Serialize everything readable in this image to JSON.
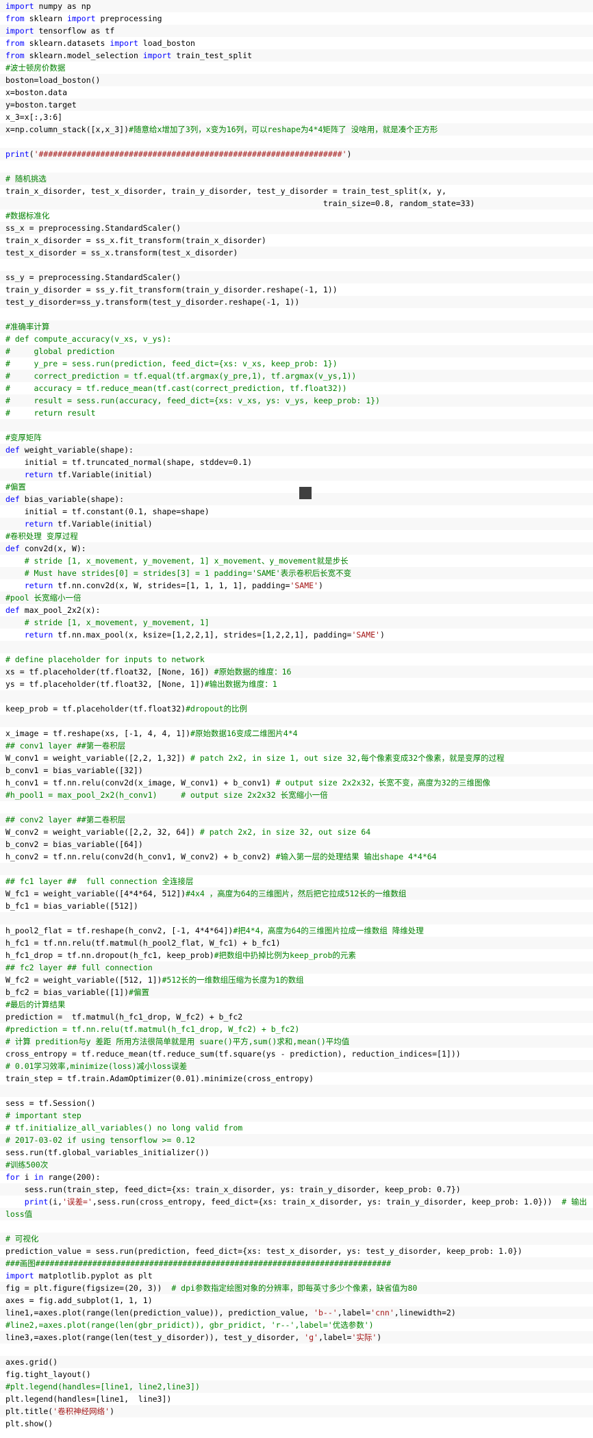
{
  "lines": [
    [
      [
        "import",
        "kw"
      ],
      [
        " numpy as np",
        ""
      ]
    ],
    [
      [
        "from",
        "kw"
      ],
      [
        " sklearn ",
        ""
      ],
      [
        "import",
        "kw"
      ],
      [
        " preprocessing",
        ""
      ]
    ],
    [
      [
        "import",
        "kw"
      ],
      [
        " tensorflow as tf",
        ""
      ]
    ],
    [
      [
        "from",
        "kw"
      ],
      [
        " sklearn.datasets ",
        ""
      ],
      [
        "import",
        "kw"
      ],
      [
        " load_boston",
        ""
      ]
    ],
    [
      [
        "from",
        "kw"
      ],
      [
        " sklearn.model_selection ",
        ""
      ],
      [
        "import",
        "kw"
      ],
      [
        " train_test_split",
        ""
      ]
    ],
    [
      [
        "#波士顿房价数据",
        "cm"
      ]
    ],
    [
      [
        "boston=load_boston()",
        ""
      ]
    ],
    [
      [
        "x=boston.data",
        ""
      ]
    ],
    [
      [
        "y=boston.target",
        ""
      ]
    ],
    [
      [
        "x_3=x[:,3:6]",
        ""
      ]
    ],
    [
      [
        "x=np.column_stack([x,x_3])",
        ""
      ],
      [
        "#随意给x增加了3列，x变为16列，可以reshape为4*4矩阵了 没啥用，就是凑个正方形",
        "cm"
      ]
    ],
    [
      [
        "",
        ""
      ]
    ],
    [
      [
        "print",
        "kw"
      ],
      [
        "(",
        ""
      ],
      [
        "'################################################################'",
        "st"
      ],
      [
        ")",
        ""
      ]
    ],
    [
      [
        "",
        ""
      ]
    ],
    [
      [
        "# 随机挑选",
        "cm"
      ]
    ],
    [
      [
        "train_x_disorder, test_x_disorder, train_y_disorder, test_y_disorder = train_test_split(x, y,",
        ""
      ]
    ],
    [
      [
        "                                                                   train_size=0.8, random_state=33)",
        ""
      ]
    ],
    [
      [
        "#数据标准化",
        "cm"
      ]
    ],
    [
      [
        "ss_x = preprocessing.StandardScaler()",
        ""
      ]
    ],
    [
      [
        "train_x_disorder = ss_x.fit_transform(train_x_disorder)",
        ""
      ]
    ],
    [
      [
        "test_x_disorder = ss_x.transform(test_x_disorder)",
        ""
      ]
    ],
    [
      [
        "",
        ""
      ]
    ],
    [
      [
        "ss_y = preprocessing.StandardScaler()",
        ""
      ]
    ],
    [
      [
        "train_y_disorder = ss_y.fit_transform(train_y_disorder.reshape(-1, 1))",
        ""
      ]
    ],
    [
      [
        "test_y_disorder=ss_y.transform(test_y_disorder.reshape(-1, 1))",
        ""
      ]
    ],
    [
      [
        "",
        ""
      ]
    ],
    [
      [
        "#准确率计算",
        "cm"
      ]
    ],
    [
      [
        "# def compute_accuracy(v_xs, v_ys):",
        "cm"
      ]
    ],
    [
      [
        "#     global prediction",
        "cm"
      ]
    ],
    [
      [
        "#     y_pre = sess.run(prediction, feed_dict={xs: v_xs, keep_prob: 1})",
        "cm"
      ]
    ],
    [
      [
        "#     correct_prediction = tf.equal(tf.argmax(y_pre,1), tf.argmax(v_ys,1))",
        "cm"
      ]
    ],
    [
      [
        "#     accuracy = tf.reduce_mean(tf.cast(correct_prediction, tf.float32))",
        "cm"
      ]
    ],
    [
      [
        "#     result = sess.run(accuracy, feed_dict={xs: v_xs, ys: v_ys, keep_prob: 1})",
        "cm"
      ]
    ],
    [
      [
        "#     return result",
        "cm"
      ]
    ],
    [
      [
        "",
        ""
      ]
    ],
    [
      [
        "#变厚矩阵",
        "cm"
      ]
    ],
    [
      [
        "def",
        "kw"
      ],
      [
        " weight_variable(shape):",
        ""
      ]
    ],
    [
      [
        "    initial = tf.truncated_normal(shape, stddev=0.1)",
        ""
      ]
    ],
    [
      [
        "    ",
        ""
      ],
      [
        "return",
        "kw"
      ],
      [
        " tf.Variable(initial)",
        ""
      ]
    ],
    [
      [
        "#偏置",
        "cm"
      ]
    ],
    [
      [
        "def",
        "kw"
      ],
      [
        " bias_variable(shape):",
        ""
      ]
    ],
    [
      [
        "    initial = tf.constant(0.1, shape=shape)",
        ""
      ]
    ],
    [
      [
        "    ",
        ""
      ],
      [
        "return",
        "kw"
      ],
      [
        " tf.Variable(initial)",
        ""
      ]
    ],
    [
      [
        "#卷积处理 变厚过程",
        "cm"
      ]
    ],
    [
      [
        "def",
        "kw"
      ],
      [
        " conv2d(x, W):",
        ""
      ]
    ],
    [
      [
        "    # stride [1, x_movement, y_movement, 1] x_movement、y_movement就是步长",
        "cm"
      ]
    ],
    [
      [
        "    # Must have strides[0] = strides[3] = 1 padding='SAME'表示卷积后长宽不变",
        "cm"
      ]
    ],
    [
      [
        "    ",
        ""
      ],
      [
        "return",
        "kw"
      ],
      [
        " tf.nn.conv2d(x, W, strides=[1, 1, 1, 1], padding=",
        ""
      ],
      [
        "'SAME'",
        "st"
      ],
      [
        ")",
        ""
      ]
    ],
    [
      [
        "#pool 长宽缩小一倍",
        "cm"
      ]
    ],
    [
      [
        "def",
        "kw"
      ],
      [
        " max_pool_2x2(x):",
        ""
      ]
    ],
    [
      [
        "    # stride [1, x_movement, y_movement, 1]",
        "cm"
      ]
    ],
    [
      [
        "    ",
        ""
      ],
      [
        "return",
        "kw"
      ],
      [
        " tf.nn.max_pool(x, ksize=[1,2,2,1], strides=[1,2,2,1], padding=",
        ""
      ],
      [
        "'SAME'",
        "st"
      ],
      [
        ")",
        ""
      ]
    ],
    [
      [
        "",
        ""
      ]
    ],
    [
      [
        "# define placeholder for inputs to network",
        "cm"
      ]
    ],
    [
      [
        "xs = tf.placeholder(tf.float32, [None, 16]) ",
        ""
      ],
      [
        "#原始数据的维度：16",
        "cm"
      ]
    ],
    [
      [
        "ys = tf.placeholder(tf.float32, [None, 1])",
        ""
      ],
      [
        "#输出数据为维度：1",
        "cm"
      ]
    ],
    [
      [
        "",
        ""
      ]
    ],
    [
      [
        "keep_prob = tf.placeholder(tf.float32)",
        ""
      ],
      [
        "#dropout的比例",
        "cm"
      ]
    ],
    [
      [
        "",
        ""
      ]
    ],
    [
      [
        "x_image = tf.reshape(xs, [-1, 4, 4, 1])",
        ""
      ],
      [
        "#原始数据16变成二维图片4*4",
        "cm"
      ]
    ],
    [
      [
        "## conv1 layer ##第一卷积层",
        "cm"
      ]
    ],
    [
      [
        "W_conv1 = weight_variable([2,2, 1,32]) ",
        ""
      ],
      [
        "# patch 2x2, in size 1, out size 32,每个像素变成32个像素，就是变厚的过程",
        "cm"
      ]
    ],
    [
      [
        "b_conv1 = bias_variable([32])",
        ""
      ]
    ],
    [
      [
        "h_conv1 = tf.nn.relu(conv2d(x_image, W_conv1) + b_conv1) ",
        ""
      ],
      [
        "# output size 2x2x32，长宽不变，高度为32的三维图像",
        "cm"
      ]
    ],
    [
      [
        "#h_pool1 = max_pool_2x2(h_conv1)     # output size 2x2x32 长宽缩小一倍",
        "cm"
      ]
    ],
    [
      [
        "",
        ""
      ]
    ],
    [
      [
        "## conv2 layer ##第二卷积层",
        "cm"
      ]
    ],
    [
      [
        "W_conv2 = weight_variable([2,2, 32, 64]) ",
        ""
      ],
      [
        "# patch 2x2, in size 32, out size 64",
        "cm"
      ]
    ],
    [
      [
        "b_conv2 = bias_variable([64])",
        ""
      ]
    ],
    [
      [
        "h_conv2 = tf.nn.relu(conv2d(h_conv1, W_conv2) + b_conv2) ",
        ""
      ],
      [
        "#输入第一层的处理结果 输出shape 4*4*64",
        "cm"
      ]
    ],
    [
      [
        "",
        ""
      ]
    ],
    [
      [
        "## fc1 layer ##  full connection 全连接层",
        "cm"
      ]
    ],
    [
      [
        "W_fc1 = weight_variable([4*4*64, 512])",
        ""
      ],
      [
        "#4x4 ，高度为64的三维图片，然后把它拉成512长的一维数组",
        "cm"
      ]
    ],
    [
      [
        "b_fc1 = bias_variable([512])",
        ""
      ]
    ],
    [
      [
        "",
        ""
      ]
    ],
    [
      [
        "h_pool2_flat = tf.reshape(h_conv2, [-1, 4*4*64])",
        ""
      ],
      [
        "#把4*4，高度为64的三维图片拉成一维数组 降维处理",
        "cm"
      ]
    ],
    [
      [
        "h_fc1 = tf.nn.relu(tf.matmul(h_pool2_flat, W_fc1) + b_fc1)",
        ""
      ]
    ],
    [
      [
        "h_fc1_drop = tf.nn.dropout(h_fc1, keep_prob)",
        ""
      ],
      [
        "#把数组中扔掉比例为keep_prob的元素",
        "cm"
      ]
    ],
    [
      [
        "## fc2 layer ## full connection",
        "cm"
      ]
    ],
    [
      [
        "W_fc2 = weight_variable([512, 1])",
        ""
      ],
      [
        "#512长的一维数组压缩为长度为1的数组",
        "cm"
      ]
    ],
    [
      [
        "b_fc2 = bias_variable([1])",
        ""
      ],
      [
        "#偏置",
        "cm"
      ]
    ],
    [
      [
        "#最后的计算结果",
        "cm"
      ]
    ],
    [
      [
        "prediction =  tf.matmul(h_fc1_drop, W_fc2) + b_fc2",
        ""
      ]
    ],
    [
      [
        "#prediction = tf.nn.relu(tf.matmul(h_fc1_drop, W_fc2) + b_fc2)",
        "cm"
      ]
    ],
    [
      [
        "# 计算 predition与y 差距 所用方法很简单就是用 suare()平方,sum()求和,mean()平均值",
        "cm"
      ]
    ],
    [
      [
        "cross_entropy = tf.reduce_mean(tf.reduce_sum(tf.square(ys - prediction), reduction_indices=[1]))",
        ""
      ]
    ],
    [
      [
        "# 0.01学习效率,minimize(loss)减小loss误差",
        "cm"
      ]
    ],
    [
      [
        "train_step = tf.train.AdamOptimizer(0.01).minimize(cross_entropy)",
        ""
      ]
    ],
    [
      [
        "",
        ""
      ]
    ],
    [
      [
        "sess = tf.Session()",
        ""
      ]
    ],
    [
      [
        "# important step",
        "cm"
      ]
    ],
    [
      [
        "# tf.initialize_all_variables() no long valid from",
        "cm"
      ]
    ],
    [
      [
        "# 2017-03-02 if using tensorflow >= 0.12",
        "cm"
      ]
    ],
    [
      [
        "sess.run(tf.global_variables_initializer())",
        ""
      ]
    ],
    [
      [
        "#训练500次",
        "cm"
      ]
    ],
    [
      [
        "for",
        "kw"
      ],
      [
        " i ",
        ""
      ],
      [
        "in",
        "kw"
      ],
      [
        " range(200):",
        ""
      ]
    ],
    [
      [
        "    sess.run(train_step, feed_dict={xs: train_x_disorder, ys: train_y_disorder, keep_prob: 0.7})",
        ""
      ]
    ],
    [
      [
        "    ",
        ""
      ],
      [
        "print",
        "kw"
      ],
      [
        "(i,",
        ""
      ],
      [
        "'误差='",
        "st"
      ],
      [
        ",sess.run(cross_entropy, feed_dict={xs: train_x_disorder, ys: train_y_disorder, keep_prob: 1.0}))  ",
        ""
      ],
      [
        "# 输出",
        "cm"
      ]
    ],
    [
      [
        "loss值",
        "cm"
      ]
    ],
    [
      [
        "",
        ""
      ]
    ],
    [
      [
        "# 可视化",
        "cm"
      ]
    ],
    [
      [
        "prediction_value = sess.run(prediction, feed_dict={xs: test_x_disorder, ys: test_y_disorder, keep_prob: 1.0})",
        ""
      ]
    ],
    [
      [
        "###画图###########################################################################",
        "cm"
      ]
    ],
    [
      [
        "import",
        "kw"
      ],
      [
        " matplotlib.pyplot as plt",
        ""
      ]
    ],
    [
      [
        "fig = plt.figure(figsize=(20, 3))  ",
        ""
      ],
      [
        "# dpi参数指定绘图对象的分辨率，即每英寸多少个像素，缺省值为80",
        "cm"
      ]
    ],
    [
      [
        "axes = fig.add_subplot(1, 1, 1)",
        ""
      ]
    ],
    [
      [
        "line1,=axes.plot(range(len(prediction_value)), prediction_value, ",
        ""
      ],
      [
        "'b--'",
        "st"
      ],
      [
        ",label=",
        ""
      ],
      [
        "'cnn'",
        "st"
      ],
      [
        ",linewidth=2)",
        ""
      ]
    ],
    [
      [
        "#line2,=axes.plot(range(len(gbr_pridict)), gbr_pridict, 'r--',label='优选参数')",
        "cm"
      ]
    ],
    [
      [
        "line3,=axes.plot(range(len(test_y_disorder)), test_y_disorder, ",
        ""
      ],
      [
        "'g'",
        "st"
      ],
      [
        ",label=",
        ""
      ],
      [
        "'实际'",
        "st"
      ],
      [
        ")",
        ""
      ]
    ],
    [
      [
        "",
        ""
      ]
    ],
    [
      [
        "axes.grid()",
        ""
      ]
    ],
    [
      [
        "fig.tight_layout()",
        ""
      ]
    ],
    [
      [
        "#plt.legend(handles=[line1, line2,line3])",
        "cm"
      ]
    ],
    [
      [
        "plt.legend(handles=[line1,  line3])",
        ""
      ]
    ],
    [
      [
        "plt.title(",
        ""
      ],
      [
        "'卷积神经网络'",
        "st"
      ],
      [
        ")",
        ""
      ]
    ],
    [
      [
        "plt.show()",
        ""
      ]
    ]
  ]
}
